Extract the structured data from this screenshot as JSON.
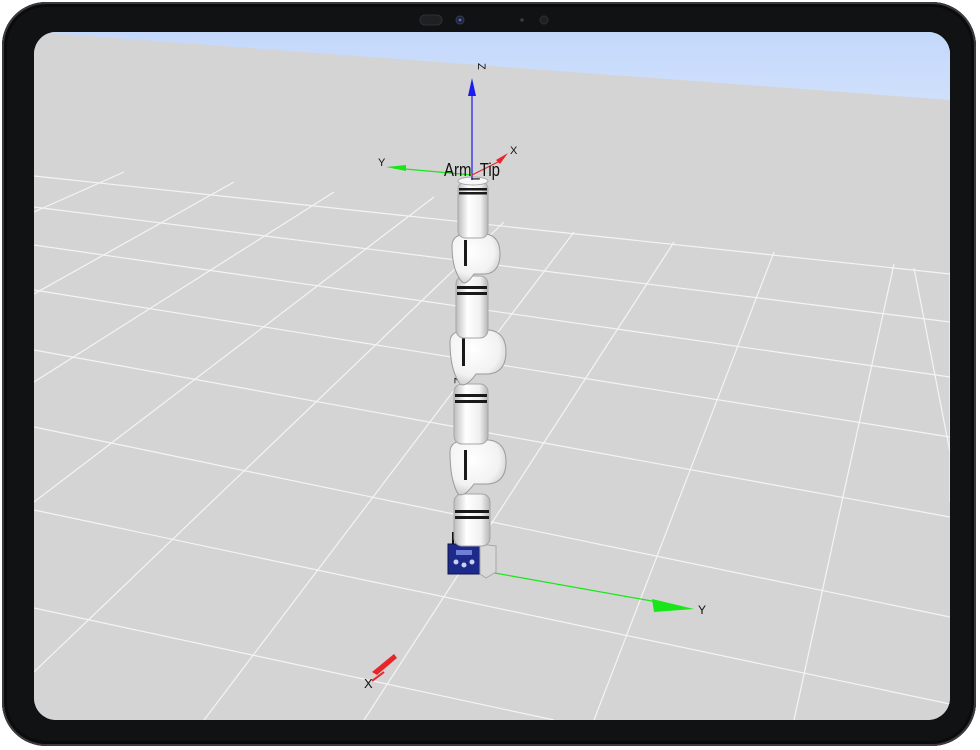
{
  "viewer": {
    "end_effector_label": "Arm_Tip",
    "base_frame": {
      "x_label": "X",
      "y_label": "Y",
      "z_label": "Z"
    },
    "tip_frame": {
      "x_label": "X",
      "y_label": "Y",
      "z_label": "Z"
    },
    "mid_frame": {
      "z_label": "Z"
    }
  },
  "colors": {
    "x_axis": "#e8262a",
    "y_axis": "#19e619",
    "z_axis": "#1c1cf0",
    "floor": "#d4d4d4",
    "grid": "#f2f2f2",
    "sky": "#c9dcfb",
    "arm_body": "#f2f2f2",
    "arm_ring": "#1a1a1a",
    "base_box": "#1d2a8a"
  },
  "icons": {
    "camera": "front-camera-icon",
    "sensor": "ambient-sensor-icon"
  }
}
